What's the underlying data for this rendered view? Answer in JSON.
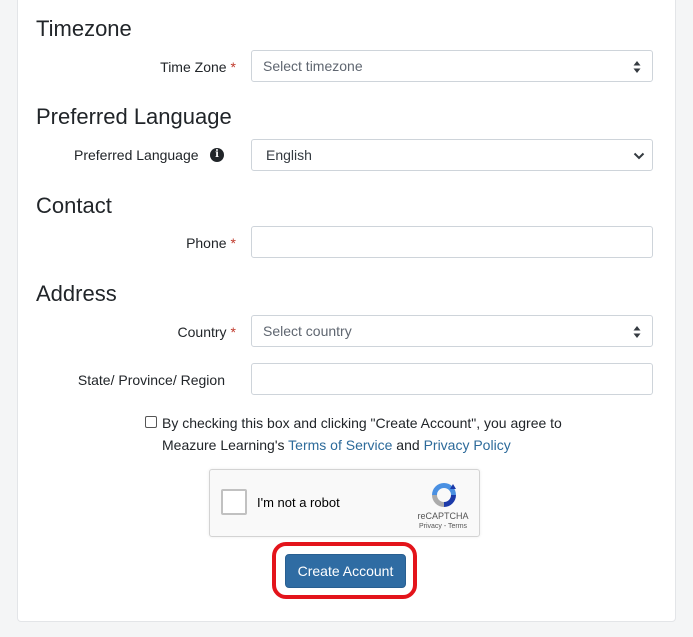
{
  "sections": {
    "timezone": {
      "title": "Timezone",
      "label": "Time Zone",
      "required_mark": "*",
      "placeholder": "Select timezone",
      "icon": "sort-icon"
    },
    "language": {
      "title": "Preferred Language",
      "label": "Preferred Language",
      "info_icon_glyph": "i",
      "value": "English",
      "icon": "chevron-down-icon"
    },
    "contact": {
      "title": "Contact",
      "phone_label": "Phone",
      "required_mark": "*",
      "phone_value": ""
    },
    "address": {
      "title": "Address",
      "country_label": "Country",
      "required_mark": "*",
      "country_placeholder": "Select country",
      "state_label": "State/ Province/ Region",
      "state_value": ""
    }
  },
  "consent": {
    "checked": false,
    "text_before": "By checking this box and clicking \"Create Account\", you agree to Meazure Learning's ",
    "terms_link": "Terms of Service",
    "conjunction": " and ",
    "privacy_link": "Privacy Policy"
  },
  "recaptcha": {
    "label": "I'm not a robot",
    "brand": "reCAPTCHA",
    "links": "Privacy - Terms"
  },
  "submit": {
    "label": "Create Account"
  },
  "colors": {
    "primary_button": "#2f6ca3",
    "link": "#2c6a9a",
    "required": "#c0392b",
    "highlight_outline": "#e3141b"
  }
}
